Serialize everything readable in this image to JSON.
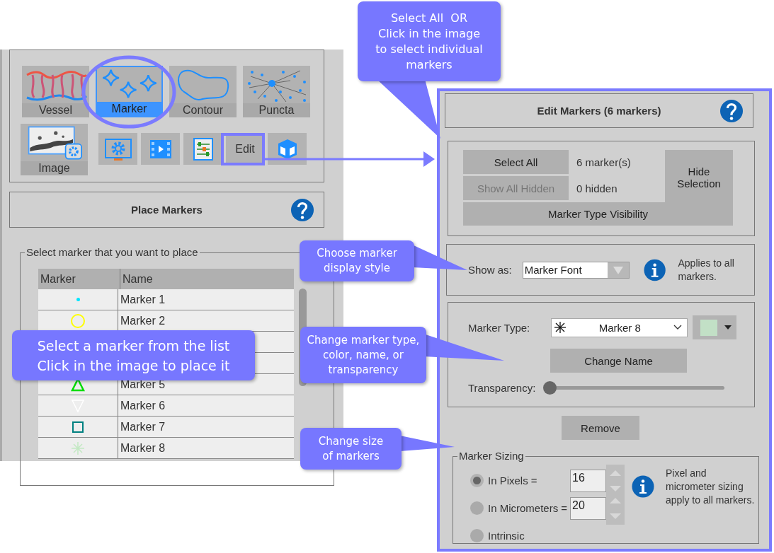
{
  "tool_panel": {
    "tools": [
      {
        "kind": "vessel",
        "label": "Vessel",
        "selected": false
      },
      {
        "kind": "marker",
        "label": "Marker",
        "selected": true
      },
      {
        "kind": "contour",
        "label": "Contour",
        "selected": false
      },
      {
        "kind": "puncta",
        "label": "Puncta",
        "selected": false
      },
      {
        "kind": "image",
        "label": "Image",
        "selected": false
      }
    ],
    "small_buttons": [
      {
        "kind": "gear"
      },
      {
        "kind": "film"
      },
      {
        "kind": "sliders"
      },
      {
        "kind": "text",
        "label": "Edit"
      },
      {
        "kind": "cube"
      }
    ]
  },
  "place_markers": {
    "title": "Place Markers",
    "legend": "Select marker that you want to place",
    "columns": [
      "Marker",
      "Name"
    ],
    "rows": [
      {
        "kind": "dot",
        "color": "#00e5ff",
        "name": "Marker 1"
      },
      {
        "kind": "circle",
        "color": "#ffff00",
        "name": "Marker 2"
      },
      {},
      {},
      {
        "kind": "triangle",
        "color": "#00dd00",
        "name": "Marker 5"
      },
      {
        "kind": "triangle-down",
        "color": "#ffffff",
        "name": "Marker 6"
      },
      {
        "kind": "square",
        "color": "#008080",
        "name": "Marker 7"
      },
      {
        "kind": "asterisk",
        "color": "#c2e8c2",
        "name": "Marker 8"
      }
    ]
  },
  "edit_markers": {
    "title": "Edit Markers (6 markers)",
    "select_all": "Select All",
    "marker_count": "6 marker(s)",
    "show_all_hidden": {
      "label": "Show All Hidden",
      "disabled": true
    },
    "hidden_count": "0 hidden",
    "hide_selection": "Hide Selection",
    "visibility": "Marker Type Visibility",
    "show_as": {
      "label": "Show as:",
      "value": "Marker Font",
      "note": "Applies to all markers."
    },
    "marker_type": {
      "label": "Marker Type:",
      "value": "Marker 8",
      "color": "#c2e0c6"
    },
    "change_name": "Change Name",
    "transparency": {
      "label": "Transparency:",
      "level": 0
    },
    "remove": "Remove",
    "sizing": {
      "legend": "Marker Sizing",
      "options": [
        {
          "label": "In Pixels =",
          "selected": true,
          "value": "16"
        },
        {
          "label": "In Micrometers =",
          "selected": false,
          "value": "20"
        },
        {
          "label": "Intrinsic",
          "selected": false
        }
      ],
      "note": "Pixel and micrometer sizing apply to all markers."
    }
  },
  "callouts": [
    {
      "text": "Select All  OR\nClick in the image\nto select individual\nmarkers"
    },
    {
      "text": "Choose marker\ndisplay style"
    },
    {
      "text": "Change marker type,\ncolor, name, or\ntransparency"
    },
    {
      "text": "Change size\nof markers"
    },
    {
      "text": "Select a marker from the list\nClick in the image to place it"
    }
  ]
}
